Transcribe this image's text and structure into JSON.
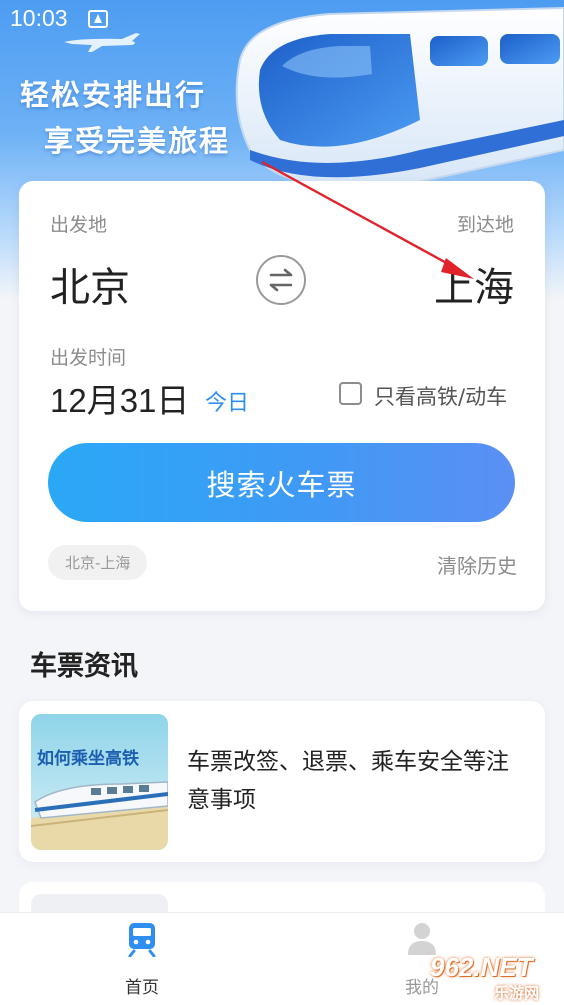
{
  "status_bar": {
    "time": "10:03",
    "icons": [
      "notification-icon",
      "wifi-icon",
      "signal-icon",
      "battery-charging-icon"
    ]
  },
  "hero": {
    "slogan_line1": "轻松安排出行",
    "slogan_line2": "享受完美旅程"
  },
  "search_card": {
    "from_label": "出发地",
    "to_label": "到达地",
    "from_city": "北京",
    "to_city": "上海",
    "date_label": "出发时间",
    "date_value": "12月31日",
    "date_relative": "今日",
    "hsr_only_label": "只看高铁/动车",
    "hsr_only_checked": false,
    "search_button": "搜索火车票",
    "history_items": [
      "北京-上海"
    ],
    "clear_history": "清除历史"
  },
  "news": {
    "section_title": "车票资讯",
    "items": [
      {
        "thumb_text": "如何乘坐高铁",
        "title": "车票改签、退票、乘车安全等注意事项"
      }
    ]
  },
  "tabbar": {
    "home_label": "首页",
    "mine_label": "我的"
  },
  "watermark": {
    "main": "962.NET",
    "sub": "乐游网"
  },
  "colors": {
    "accent": "#2f8ff0",
    "hero_top": "#4d9cf2",
    "button_start": "#2aa8f6",
    "button_end": "#5b8ff3",
    "background": "#f4f5f9"
  }
}
